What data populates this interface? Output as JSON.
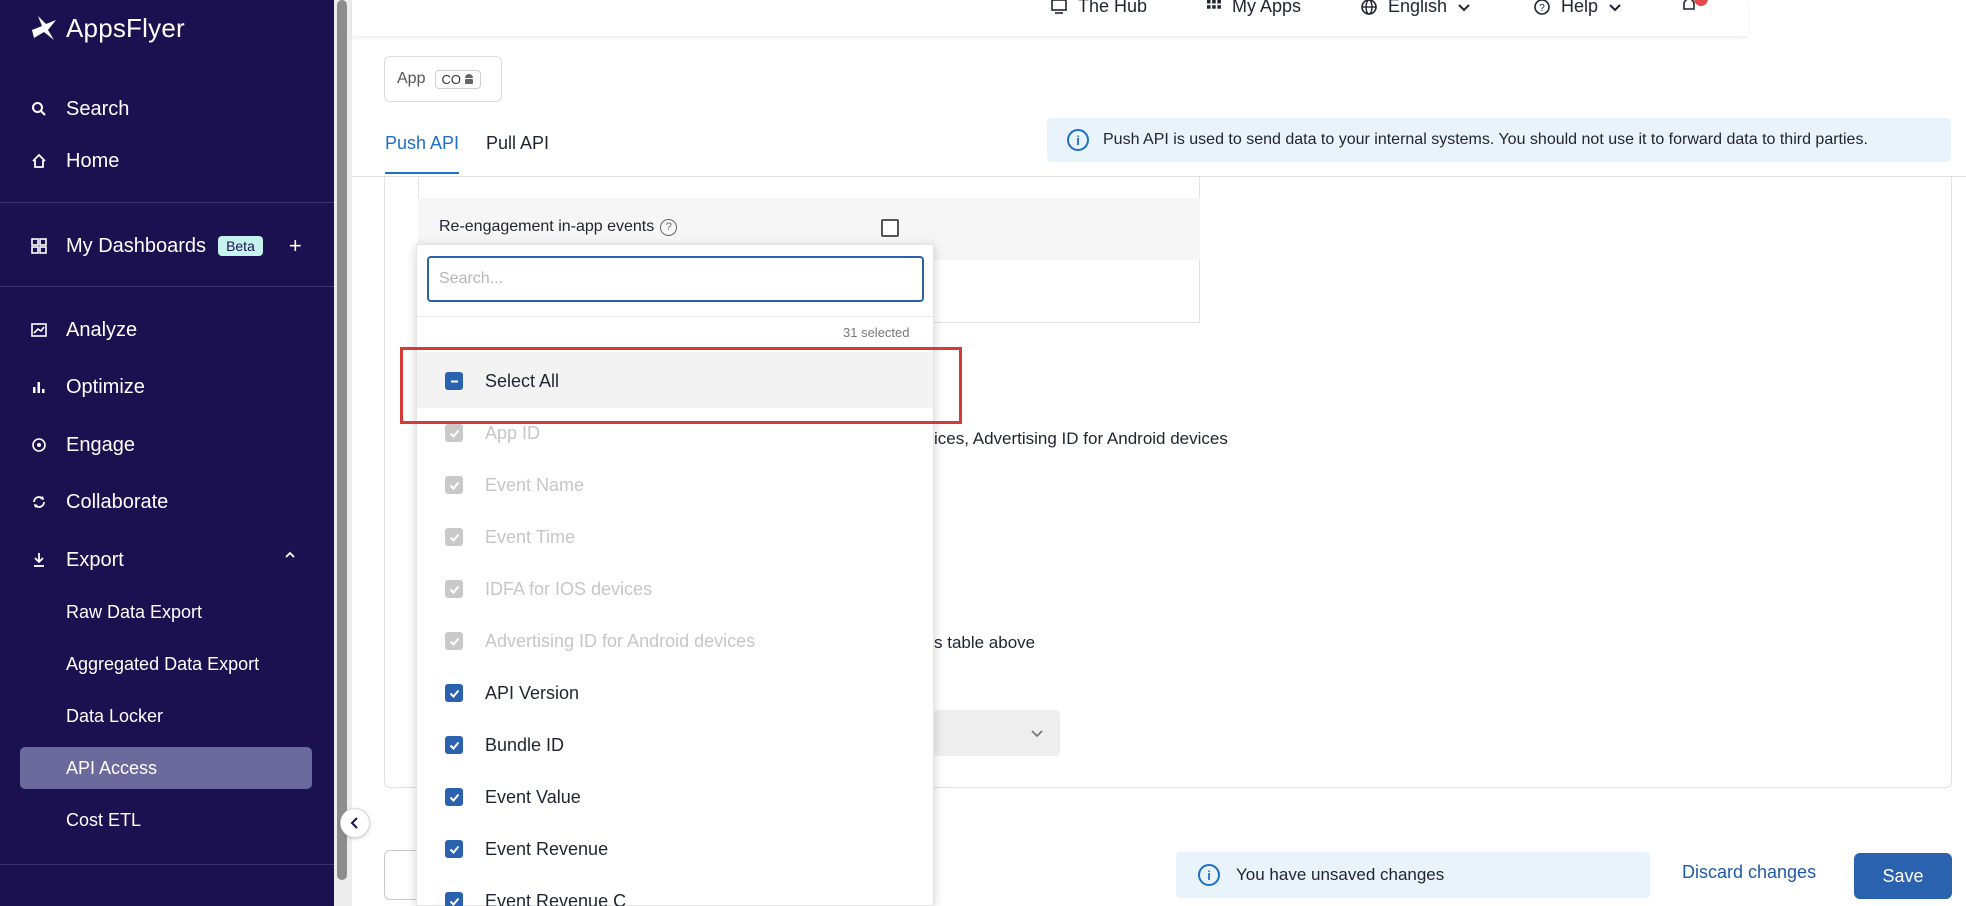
{
  "sidebar": {
    "logo_text": "AppsFlyer",
    "nav": {
      "search": "Search",
      "home": "Home",
      "dashboards": "My Dashboards",
      "dashboards_badge": "Beta",
      "dashboards_add": "+",
      "analyze": "Analyze",
      "optimize": "Optimize",
      "engage": "Engage",
      "collaborate": "Collaborate",
      "export": "Export"
    },
    "export_items": [
      "Raw Data Export",
      "Aggregated Data Export",
      "Data Locker",
      "API Access",
      "Cost ETL"
    ],
    "active_item": "API Access"
  },
  "topbar": {
    "hub": "The Hub",
    "my_apps": "My Apps",
    "language": "English",
    "help": "Help"
  },
  "app_selector": {
    "label": "App",
    "value": "CO"
  },
  "tabs": {
    "push": "Push API",
    "pull": "Pull API",
    "active": "Push API"
  },
  "info_banner": "Push API is used to send data to your internal systems. You should not use it to forward data to third parties.",
  "reengagement": {
    "label": "Re-engagement in-app events"
  },
  "background_text": {
    "fields_line": "ices, Advertising ID for Android devices",
    "table_line": "s table above"
  },
  "dropdown": {
    "search_placeholder": "Search...",
    "selected_count": "31 selected",
    "select_all": "Select All",
    "disabled_options": [
      "App ID",
      "Event Name",
      "Event Time",
      "IDFA for IOS devices",
      "Advertising ID for Android devices"
    ],
    "enabled_options": [
      "API Version",
      "Bundle ID",
      "Event Value",
      "Event Revenue",
      "Event Revenue C"
    ]
  },
  "footer": {
    "unsaved": "You have unsaved changes",
    "discard": "Discard changes",
    "save": "Save"
  },
  "colors": {
    "sidebar_bg": "#1c1150",
    "primary": "#2a62b0",
    "highlight": "#d33b35"
  }
}
